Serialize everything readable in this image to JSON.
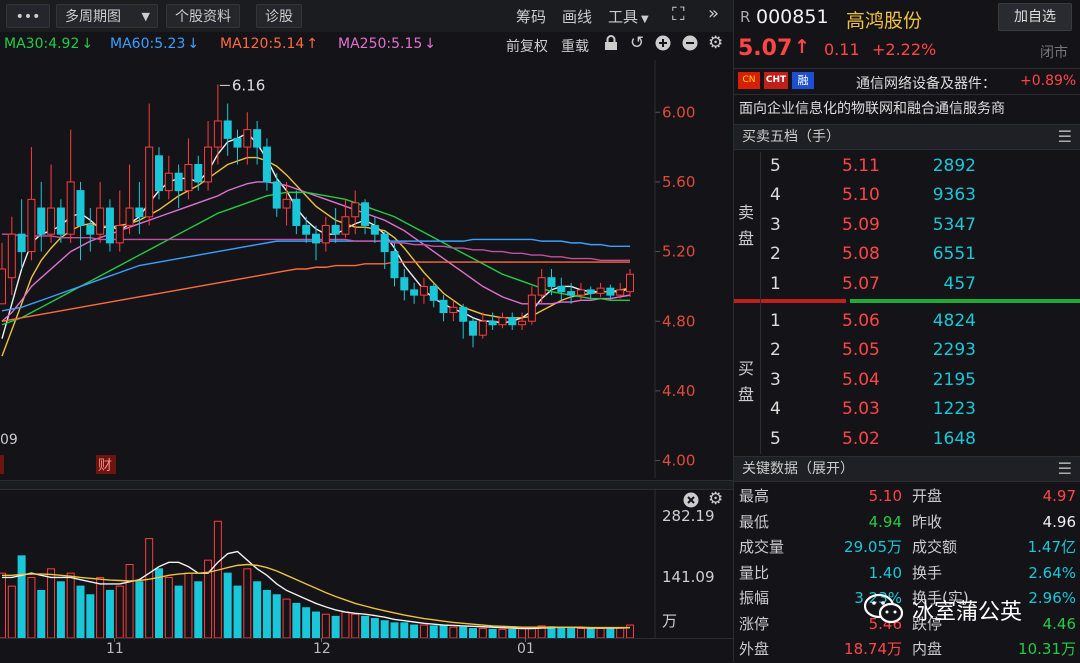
{
  "toolbar": {
    "more": "•••",
    "period": "多周期图",
    "stock_info": "个股资料",
    "diagnose": "诊股",
    "chips": "筹码",
    "draw": "画线",
    "tools": "工具",
    "fullscreen_icon": "expand-icon",
    "collapse_icon": "double-chevron-right-icon"
  },
  "ma_bar": {
    "items": [
      {
        "label": "MA30:4.92",
        "arrow": "↓",
        "color": "#22cc44"
      },
      {
        "label": "MA60:5.23",
        "arrow": "↓",
        "color": "#3aa0ff"
      },
      {
        "label": "MA120:5.14",
        "arrow": "↑",
        "color": "#ff6a3d"
      },
      {
        "label": "MA250:5.15",
        "arrow": "↓",
        "color": "#e070d0"
      }
    ],
    "adjust": "前复权",
    "overlay": "重载"
  },
  "chart_data": {
    "type": "candlestick",
    "ylim": [
      3.9,
      6.3
    ],
    "y_ticks": [
      "6.00",
      "5.60",
      "5.20",
      "4.80",
      "4.40",
      "4.00"
    ],
    "max_label": "6.16",
    "left_date_label": "09",
    "event_marks": [
      "财"
    ],
    "x_ticks": [
      "11",
      "12",
      "01"
    ],
    "candles": [
      [
        4.9,
        5.1,
        5.05,
        5.25
      ],
      [
        5.05,
        5.3,
        4.95,
        5.4
      ],
      [
        5.3,
        5.2,
        5.1,
        5.5
      ],
      [
        5.2,
        5.5,
        5.15,
        5.8
      ],
      [
        5.45,
        5.3,
        5.2,
        5.6
      ],
      [
        5.3,
        5.45,
        5.25,
        5.7
      ],
      [
        5.45,
        5.3,
        5.25,
        5.5
      ],
      [
        5.3,
        5.6,
        5.25,
        5.9
      ],
      [
        5.55,
        5.35,
        5.15,
        5.6
      ],
      [
        5.35,
        5.3,
        5.2,
        5.45
      ],
      [
        5.3,
        5.45,
        5.25,
        5.6
      ],
      [
        5.45,
        5.25,
        5.2,
        5.5
      ],
      [
        5.25,
        5.35,
        5.2,
        5.55
      ],
      [
        5.35,
        5.45,
        5.3,
        5.7
      ],
      [
        5.45,
        5.4,
        5.3,
        5.6
      ],
      [
        5.4,
        5.8,
        5.35,
        6.05
      ],
      [
        5.75,
        5.55,
        5.5,
        5.8
      ],
      [
        5.55,
        5.65,
        5.5,
        5.75
      ],
      [
        5.65,
        5.55,
        5.45,
        5.7
      ],
      [
        5.55,
        5.7,
        5.5,
        5.85
      ],
      [
        5.7,
        5.6,
        5.55,
        5.75
      ],
      [
        5.6,
        5.8,
        5.55,
        5.95
      ],
      [
        5.8,
        5.95,
        5.7,
        6.16
      ],
      [
        5.95,
        5.85,
        5.75,
        6.05
      ],
      [
        5.85,
        5.8,
        5.7,
        5.9
      ],
      [
        5.8,
        5.9,
        5.7,
        6.0
      ],
      [
        5.9,
        5.8,
        5.7,
        5.95
      ],
      [
        5.8,
        5.6,
        5.55,
        5.85
      ],
      [
        5.6,
        5.45,
        5.4,
        5.65
      ],
      [
        5.45,
        5.5,
        5.35,
        5.6
      ],
      [
        5.5,
        5.35,
        5.3,
        5.55
      ],
      [
        5.35,
        5.3,
        5.25,
        5.4
      ],
      [
        5.3,
        5.25,
        5.15,
        5.35
      ],
      [
        5.25,
        5.35,
        5.2,
        5.4
      ],
      [
        5.35,
        5.3,
        5.25,
        5.45
      ],
      [
        5.3,
        5.4,
        5.28,
        5.5
      ],
      [
        5.4,
        5.48,
        5.3,
        5.55
      ],
      [
        5.48,
        5.35,
        5.3,
        5.5
      ],
      [
        5.35,
        5.3,
        5.25,
        5.4
      ],
      [
        5.3,
        5.2,
        5.1,
        5.32
      ],
      [
        5.2,
        5.05,
        5.0,
        5.25
      ],
      [
        5.05,
        4.98,
        4.92,
        5.1
      ],
      [
        4.98,
        4.95,
        4.9,
        5.02
      ],
      [
        4.95,
        5.0,
        4.9,
        5.05
      ],
      [
        5.0,
        4.92,
        4.88,
        5.02
      ],
      [
        4.92,
        4.85,
        4.8,
        4.95
      ],
      [
        4.85,
        4.88,
        4.8,
        4.92
      ],
      [
        4.88,
        4.8,
        4.7,
        4.9
      ],
      [
        4.8,
        4.72,
        4.65,
        4.82
      ],
      [
        4.72,
        4.8,
        4.7,
        4.85
      ],
      [
        4.8,
        4.78,
        4.75,
        4.85
      ],
      [
        4.78,
        4.82,
        4.76,
        4.85
      ],
      [
        4.82,
        4.78,
        4.75,
        4.85
      ],
      [
        4.78,
        4.8,
        4.75,
        4.85
      ],
      [
        4.8,
        4.95,
        4.78,
        5.0
      ],
      [
        4.95,
        5.05,
        4.9,
        5.1
      ],
      [
        5.05,
        5.0,
        4.95,
        5.1
      ],
      [
        5.0,
        4.97,
        4.92,
        5.05
      ],
      [
        4.97,
        4.95,
        4.9,
        5.02
      ],
      [
        4.95,
        4.98,
        4.92,
        5.02
      ],
      [
        4.98,
        4.96,
        4.93,
        5.0
      ],
      [
        4.96,
        4.99,
        4.94,
        5.02
      ],
      [
        4.99,
        4.95,
        4.92,
        5.01
      ],
      [
        4.95,
        4.98,
        4.93,
        5.02
      ],
      [
        4.97,
        5.07,
        4.94,
        5.1
      ]
    ],
    "ma_lines": [
      {
        "name": "MA5",
        "color": "#f0f0f0",
        "values": [
          4.7,
          4.9,
          5.1,
          5.25,
          5.3,
          5.32,
          5.35,
          5.4,
          5.42,
          5.38,
          5.33,
          5.35,
          5.32,
          5.36,
          5.4,
          5.48,
          5.55,
          5.6,
          5.62,
          5.62,
          5.6,
          5.66,
          5.76,
          5.83,
          5.85,
          5.88,
          5.82,
          5.73,
          5.62,
          5.55,
          5.45,
          5.38,
          5.33,
          5.3,
          5.3,
          5.33,
          5.36,
          5.38,
          5.35,
          5.3,
          5.22,
          5.12,
          5.05,
          4.98,
          4.93,
          4.9,
          4.87,
          4.85,
          4.82,
          4.8,
          4.8,
          4.79,
          4.8,
          4.82,
          4.86,
          4.93,
          4.98,
          5.0,
          5.0,
          4.98,
          4.97,
          4.97,
          4.97,
          4.97,
          4.99
        ]
      },
      {
        "name": "MA10",
        "color": "#f0c040",
        "values": [
          4.6,
          4.75,
          4.9,
          5.05,
          5.15,
          5.22,
          5.28,
          5.32,
          5.35,
          5.36,
          5.35,
          5.34,
          5.35,
          5.36,
          5.38,
          5.41,
          5.44,
          5.48,
          5.52,
          5.55,
          5.58,
          5.62,
          5.66,
          5.7,
          5.72,
          5.74,
          5.74,
          5.72,
          5.69,
          5.64,
          5.58,
          5.52,
          5.46,
          5.42,
          5.38,
          5.36,
          5.34,
          5.34,
          5.33,
          5.32,
          5.28,
          5.22,
          5.15,
          5.08,
          5.02,
          4.96,
          4.92,
          4.88,
          4.86,
          4.84,
          4.83,
          4.82,
          4.82,
          4.82,
          4.83,
          4.86,
          4.89,
          4.92,
          4.94,
          4.95,
          4.96,
          4.97,
          4.97,
          4.98,
          4.99
        ]
      },
      {
        "name": "MA20",
        "color": "#e070d0",
        "values": [
          4.8,
          4.85,
          4.92,
          5.0,
          5.05,
          5.1,
          5.15,
          5.2,
          5.23,
          5.26,
          5.28,
          5.3,
          5.32,
          5.34,
          5.36,
          5.38,
          5.4,
          5.42,
          5.44,
          5.46,
          5.48,
          5.5,
          5.52,
          5.55,
          5.57,
          5.59,
          5.6,
          5.6,
          5.59,
          5.58,
          5.56,
          5.54,
          5.52,
          5.5,
          5.48,
          5.46,
          5.44,
          5.42,
          5.4,
          5.38,
          5.35,
          5.32,
          5.28,
          5.24,
          5.2,
          5.16,
          5.12,
          5.08,
          5.04,
          5.0,
          4.97,
          4.94,
          4.92,
          4.9,
          4.9,
          4.9,
          4.9,
          4.91,
          4.91,
          4.92,
          4.92,
          4.93,
          4.93,
          4.94,
          4.95
        ]
      },
      {
        "name": "MA30",
        "color": "#22cc44",
        "values": [
          4.78,
          4.8,
          4.82,
          4.85,
          4.88,
          4.91,
          4.94,
          4.97,
          5.0,
          5.03,
          5.06,
          5.09,
          5.12,
          5.15,
          5.18,
          5.21,
          5.24,
          5.27,
          5.3,
          5.33,
          5.36,
          5.39,
          5.42,
          5.44,
          5.46,
          5.48,
          5.5,
          5.52,
          5.53,
          5.54,
          5.54,
          5.54,
          5.53,
          5.52,
          5.51,
          5.5,
          5.48,
          5.46,
          5.44,
          5.42,
          5.4,
          5.37,
          5.34,
          5.31,
          5.28,
          5.25,
          5.22,
          5.19,
          5.16,
          5.13,
          5.1,
          5.07,
          5.05,
          5.03,
          5.01,
          4.99,
          4.97,
          4.96,
          4.95,
          4.94,
          4.93,
          4.93,
          4.92,
          4.92,
          4.92
        ]
      },
      {
        "name": "MA60",
        "color": "#3aa0ff",
        "values": [
          4.86,
          4.87,
          4.88,
          4.9,
          4.92,
          4.94,
          4.96,
          4.98,
          5.0,
          5.02,
          5.04,
          5.06,
          5.08,
          5.1,
          5.12,
          5.13,
          5.14,
          5.15,
          5.16,
          5.17,
          5.18,
          5.19,
          5.2,
          5.21,
          5.22,
          5.23,
          5.24,
          5.25,
          5.26,
          5.26,
          5.26,
          5.26,
          5.26,
          5.26,
          5.26,
          5.26,
          5.26,
          5.26,
          5.26,
          5.26,
          5.26,
          5.26,
          5.26,
          5.26,
          5.26,
          5.26,
          5.26,
          5.26,
          5.27,
          5.27,
          5.27,
          5.27,
          5.27,
          5.27,
          5.27,
          5.26,
          5.26,
          5.26,
          5.25,
          5.25,
          5.24,
          5.24,
          5.23,
          5.23,
          5.23
        ]
      },
      {
        "name": "MA120",
        "color": "#ff6a3d",
        "values": [
          4.8,
          4.81,
          4.82,
          4.83,
          4.84,
          4.85,
          4.86,
          4.87,
          4.88,
          4.89,
          4.9,
          4.91,
          4.92,
          4.93,
          4.94,
          4.95,
          4.96,
          4.97,
          4.98,
          4.99,
          5.0,
          5.01,
          5.02,
          5.03,
          5.04,
          5.05,
          5.06,
          5.07,
          5.08,
          5.09,
          5.1,
          5.1,
          5.11,
          5.11,
          5.12,
          5.12,
          5.12,
          5.13,
          5.13,
          5.13,
          5.14,
          5.14,
          5.14,
          5.14,
          5.14,
          5.14,
          5.14,
          5.14,
          5.14,
          5.14,
          5.14,
          5.14,
          5.14,
          5.14,
          5.14,
          5.14,
          5.14,
          5.14,
          5.14,
          5.14,
          5.14,
          5.14,
          5.14,
          5.14,
          5.14
        ]
      },
      {
        "name": "MA250",
        "color": "#c050a0",
        "values": [
          5.3,
          5.3,
          5.29,
          5.29,
          5.29,
          5.29,
          5.28,
          5.28,
          5.28,
          5.28,
          5.27,
          5.27,
          5.27,
          5.27,
          5.27,
          5.27,
          5.27,
          5.27,
          5.27,
          5.27,
          5.27,
          5.27,
          5.27,
          5.27,
          5.27,
          5.27,
          5.27,
          5.27,
          5.27,
          5.27,
          5.27,
          5.27,
          5.27,
          5.27,
          5.27,
          5.27,
          5.26,
          5.26,
          5.26,
          5.26,
          5.25,
          5.25,
          5.24,
          5.24,
          5.23,
          5.23,
          5.22,
          5.22,
          5.21,
          5.21,
          5.2,
          5.2,
          5.19,
          5.19,
          5.18,
          5.18,
          5.17,
          5.17,
          5.16,
          5.16,
          5.16,
          5.15,
          5.15,
          5.15,
          5.15
        ]
      }
    ],
    "volume": {
      "ylim": [
        0,
        282.19
      ],
      "ticks": [
        "282.19",
        "141.09"
      ],
      "unit": "万",
      "values": [
        150,
        120,
        190,
        140,
        110,
        160,
        130,
        150,
        120,
        100,
        140,
        110,
        120,
        170,
        130,
        230,
        160,
        140,
        120,
        150,
        130,
        180,
        270,
        150,
        120,
        160,
        130,
        110,
        100,
        90,
        80,
        70,
        60,
        55,
        50,
        60,
        55,
        50,
        45,
        40,
        35,
        35,
        30,
        30,
        28,
        28,
        25,
        25,
        22,
        22,
        20,
        20,
        20,
        22,
        25,
        28,
        26,
        25,
        24,
        22,
        22,
        22,
        22,
        24,
        30
      ],
      "ma_lines": [
        {
          "color": "#f0f0f0",
          "values": [
            140,
            140,
            145,
            150,
            145,
            140,
            140,
            140,
            135,
            130,
            125,
            125,
            125,
            130,
            135,
            150,
            165,
            175,
            175,
            165,
            150,
            150,
            175,
            195,
            200,
            180,
            160,
            145,
            125,
            110,
            100,
            90,
            80,
            72,
            65,
            60,
            57,
            55,
            52,
            48,
            43,
            40,
            37,
            34,
            32,
            30,
            29,
            28,
            27,
            26,
            25,
            24,
            23,
            22,
            22,
            23,
            24,
            25,
            25,
            24,
            23,
            23,
            23,
            23,
            24
          ]
        },
        {
          "color": "#f0c040",
          "values": [
            145,
            145,
            147,
            148,
            148,
            147,
            145,
            143,
            140,
            138,
            136,
            134,
            133,
            132,
            133,
            136,
            140,
            145,
            148,
            150,
            150,
            152,
            157,
            163,
            168,
            170,
            168,
            163,
            155,
            145,
            135,
            125,
            115,
            105,
            96,
            88,
            80,
            74,
            68,
            63,
            58,
            53,
            49,
            45,
            42,
            39,
            36,
            34,
            32,
            30,
            28,
            27,
            26,
            25,
            25,
            25,
            25,
            25,
            25,
            25,
            24,
            24,
            24,
            24,
            24
          ]
        }
      ]
    }
  },
  "header": {
    "prefix": "R",
    "code": "000851",
    "name": "高鸿股份",
    "add_button": "加自选",
    "price": "5.07",
    "arrow": "↑",
    "change": "0.11",
    "pct": "+2.22%",
    "status": "闭市"
  },
  "industry": {
    "flag_cn": "CN",
    "tag_cht": "CHT",
    "tag_rong": "融",
    "name": "通信网络设备及器件：",
    "pct": "+0.89%"
  },
  "description": "面向企业信息化的物联网和融合通信服务商",
  "order_book": {
    "title": "买卖五档（手）",
    "sell_label": [
      "卖",
      "盘"
    ],
    "buy_label": [
      "买",
      "盘"
    ],
    "sells": [
      {
        "lvl": "5",
        "price": "5.11",
        "vol": "2892"
      },
      {
        "lvl": "4",
        "price": "5.10",
        "vol": "9363"
      },
      {
        "lvl": "3",
        "price": "5.09",
        "vol": "5347"
      },
      {
        "lvl": "2",
        "price": "5.08",
        "vol": "6551"
      },
      {
        "lvl": "1",
        "price": "5.07",
        "vol": "457"
      }
    ],
    "buys": [
      {
        "lvl": "1",
        "price": "5.06",
        "vol": "4824"
      },
      {
        "lvl": "2",
        "price": "5.05",
        "vol": "2293"
      },
      {
        "lvl": "3",
        "price": "5.04",
        "vol": "2195"
      },
      {
        "lvl": "4",
        "price": "5.03",
        "vol": "1223"
      },
      {
        "lvl": "5",
        "price": "5.02",
        "vol": "1648"
      }
    ]
  },
  "key_data": {
    "title": "关键数据（展开）",
    "rows": [
      {
        "l1": "最高",
        "v1": "5.10",
        "c1": "#ff4545",
        "l2": "开盘",
        "v2": "4.97",
        "c2": "#ff4545"
      },
      {
        "l1": "最低",
        "v1": "4.94",
        "c1": "#22cc44",
        "l2": "昨收",
        "v2": "4.96",
        "c2": "#f0f0f0"
      },
      {
        "l1": "成交量",
        "v1": "29.05万",
        "c1": "#19c7d9",
        "l2": "成交额",
        "v2": "1.47亿",
        "c2": "#19c7d9"
      },
      {
        "l1": "量比",
        "v1": "1.40",
        "c1": "#19c7d9",
        "l2": "换手",
        "v2": "2.64%",
        "c2": "#19c7d9"
      },
      {
        "l1": "振幅",
        "v1": "3.23%",
        "c1": "#19c7d9",
        "l2": "换手(实)",
        "v2": "2.96%",
        "c2": "#19c7d9"
      },
      {
        "l1": "涨停",
        "v1": "5.46",
        "c1": "#ff4545",
        "l2": "跌停",
        "v2": "4.46",
        "c2": "#22cc44"
      },
      {
        "l1": "外盘",
        "v1": "18.74万",
        "c1": "#ff4545",
        "l2": "内盘",
        "v2": "10.31万",
        "c2": "#22cc44"
      }
    ]
  },
  "watermark": "冰室蒲公英"
}
